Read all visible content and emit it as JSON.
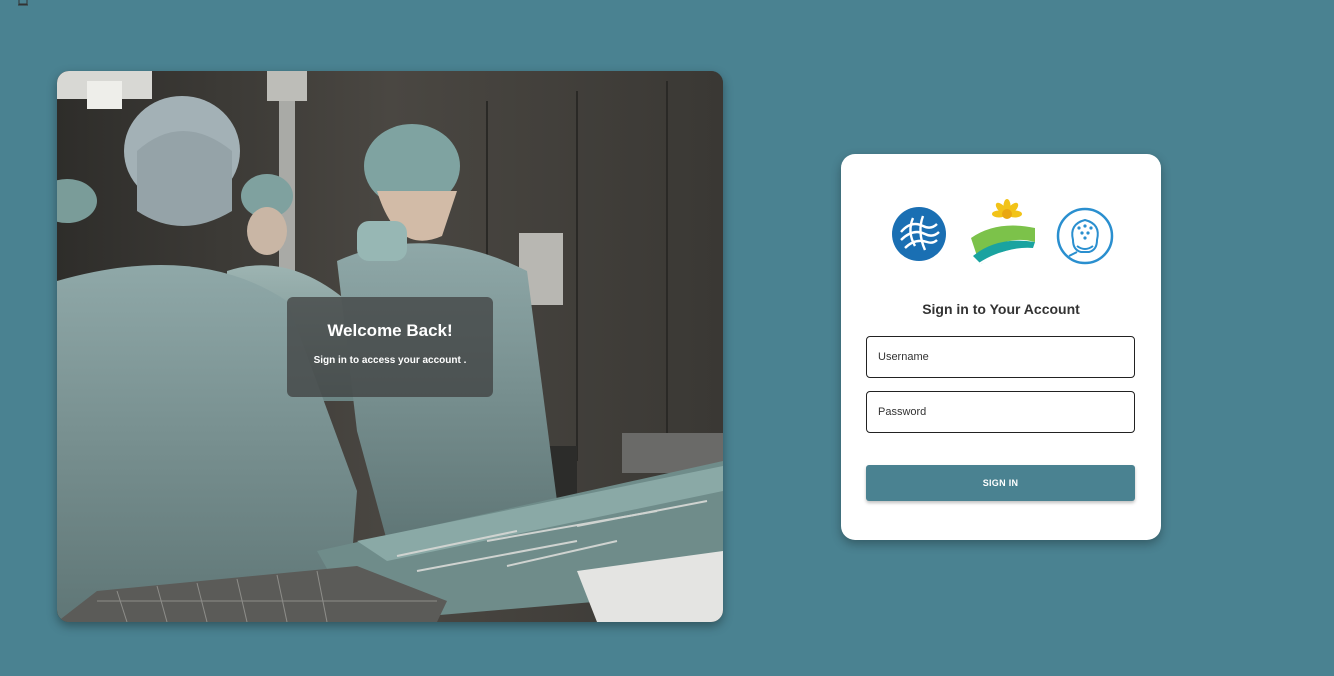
{
  "hero": {
    "welcome_title": "Welcome Back!",
    "welcome_subtitle": "Sign in to access your account ."
  },
  "login": {
    "title": "Sign in to Your Account",
    "username_placeholder": "Username",
    "password_placeholder": "Password",
    "signin_label": "SIGN IN",
    "logos": [
      "blue-woven-circle-logo",
      "green-sun-road-logo",
      "head-outline-logo"
    ]
  },
  "colors": {
    "background": "#4a8291",
    "button": "#4a8291",
    "card": "#ffffff"
  }
}
